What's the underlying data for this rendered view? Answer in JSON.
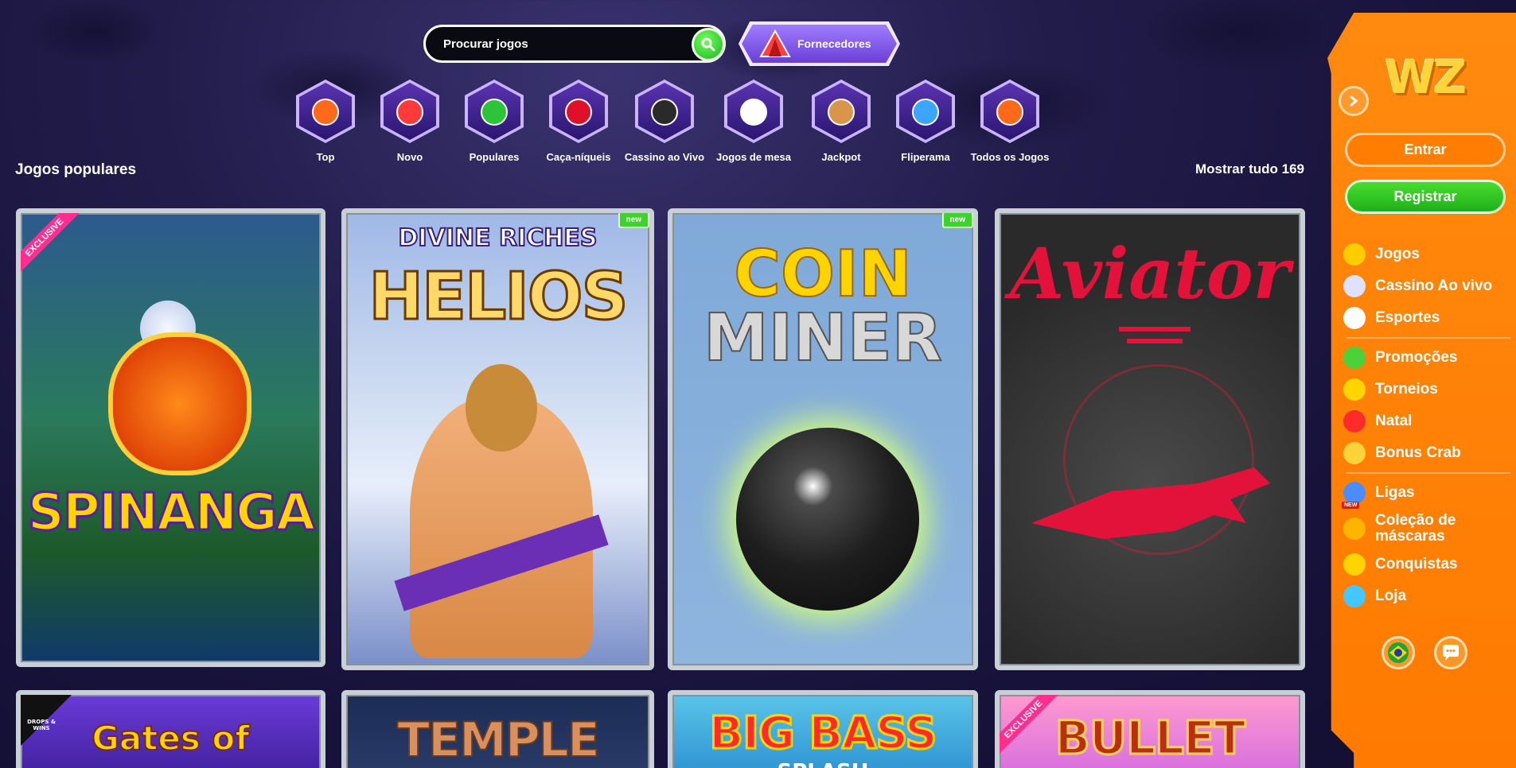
{
  "search": {
    "placeholder": "Procurar jogos"
  },
  "providers": {
    "label": "Fornecedores"
  },
  "categories": [
    {
      "label": "Top",
      "icon": "fire-icon"
    },
    {
      "label": "Novo",
      "icon": "clock-icon"
    },
    {
      "label": "Populares",
      "icon": "clover-icon"
    },
    {
      "label": "Caça-níqueis",
      "icon": "cherry-icon"
    },
    {
      "label": "Cassino ao Vivo",
      "icon": "dealer-icon"
    },
    {
      "label": "Jogos de mesa",
      "icon": "cards-icon"
    },
    {
      "label": "Jackpot",
      "icon": "money-bag-icon"
    },
    {
      "label": "Fliperama",
      "icon": "joystick-icon"
    },
    {
      "label": "Todos os Jogos",
      "icon": "book-icon"
    }
  ],
  "section": {
    "title": "Jogos populares",
    "show_all": "Mostrar tudo 169"
  },
  "games": [
    {
      "title": "SPINANGA",
      "ribbon": "EXCLUSIVE"
    },
    {
      "title_top": "DIVINE RICHES",
      "title": "HELIOS",
      "badge": "new"
    },
    {
      "title": "COIN",
      "title2": "MINER",
      "badge": "new"
    },
    {
      "title": "Aviator"
    },
    {
      "title": "Gates of",
      "badge_left": "DROPS & WINS"
    },
    {
      "title": "TEMPLE"
    },
    {
      "title": "BIG BASS",
      "title2": "SPLASH"
    },
    {
      "title": "BULLET",
      "ribbon": "EXCLUSIVE"
    }
  ],
  "sidebar": {
    "logo": "WZ",
    "login": "Entrar",
    "register": "Registrar",
    "menu_a": [
      {
        "label": "Jogos",
        "icon": "play-icon",
        "color": "#ffcc00"
      },
      {
        "label": "Cassino Ao vivo",
        "icon": "spade-icon",
        "color": "#e0e0ff"
      },
      {
        "label": "Esportes",
        "icon": "soccer-ball-icon",
        "color": "#ffffff"
      }
    ],
    "menu_b": [
      {
        "label": "Promoções",
        "icon": "gift-icon",
        "color": "#4bd23a"
      },
      {
        "label": "Torneios",
        "icon": "trophy-icon",
        "color": "#ffd400"
      },
      {
        "label": "Natal",
        "icon": "santa-hat-icon",
        "color": "#ff2a2a"
      },
      {
        "label": "Bonus Crab",
        "icon": "crab-icon",
        "color": "#ffd23a"
      }
    ],
    "menu_c": [
      {
        "label": "Ligas",
        "icon": "league-icon",
        "color": "#4b8cff",
        "new": "NEW"
      },
      {
        "label": "Coleção de máscaras",
        "icon": "mask-icon",
        "color": "#ffb400"
      },
      {
        "label": "Conquistas",
        "icon": "crown-icon",
        "color": "#ffd400"
      },
      {
        "label": "Loja",
        "icon": "potion-icon",
        "color": "#46c6ff"
      }
    ]
  }
}
